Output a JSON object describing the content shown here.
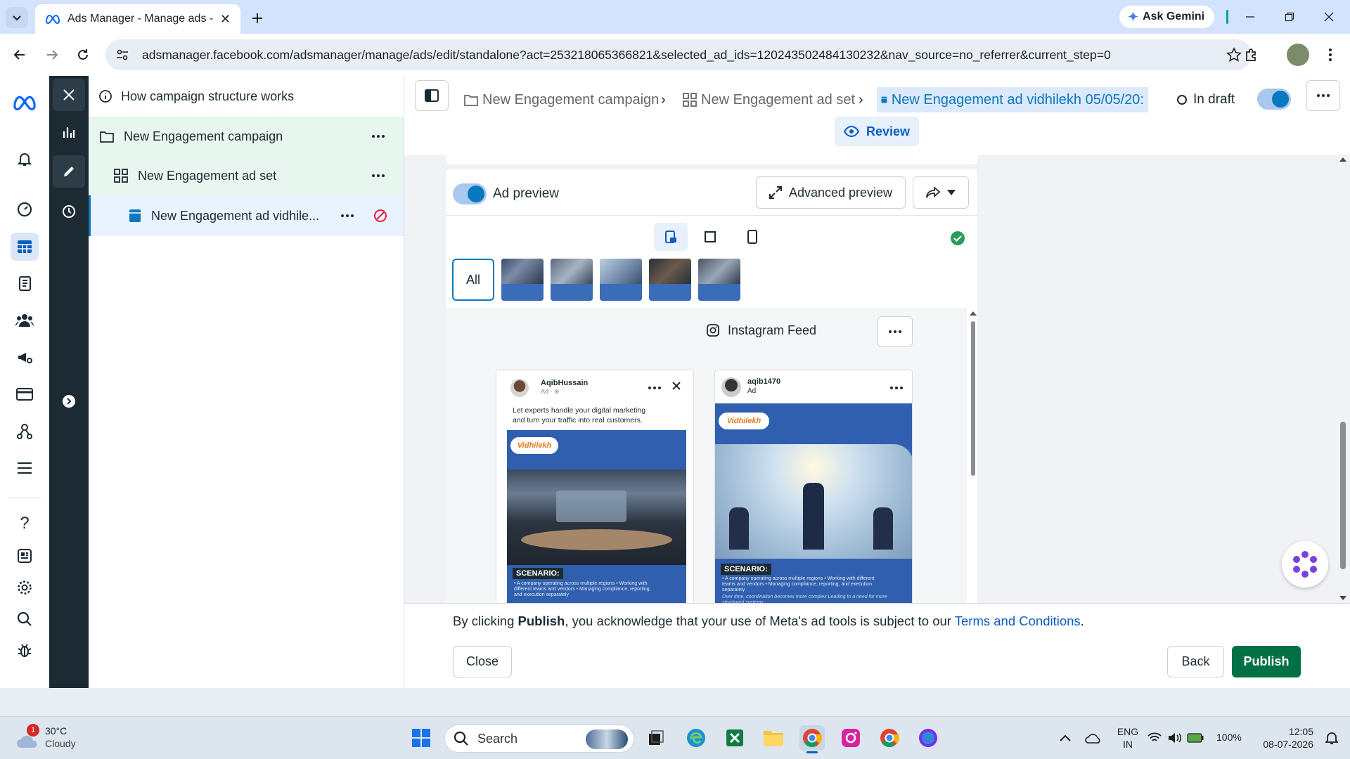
{
  "browser": {
    "tab_title": "Ads Manager - Manage ads - Ad",
    "ask_gemini": "Ask Gemini",
    "url": "adsmanager.facebook.com/adsmanager/manage/ads/edit/standalone?act=253218065366821&selected_ad_ids=120243502484130232&nav_source=no_referrer&current_step=0"
  },
  "tree": {
    "info_label": "How campaign structure works",
    "campaign": "New Engagement campaign",
    "adset": "New Engagement ad set",
    "ad": "New Engagement ad vidhile..."
  },
  "header": {
    "crumb_campaign": "New Engagement campaign",
    "crumb_adset": "New Engagement ad set",
    "crumb_ad": "New Engagement ad vidhilekh 05/05/20:",
    "status": "In draft",
    "review": "Review"
  },
  "preview": {
    "toggle_label": "Ad preview",
    "advanced": "Advanced preview",
    "all": "All",
    "placement": "Instagram Feed",
    "post1": {
      "user": "AqibHussain",
      "sub": "Ad · ⊕",
      "caption": "Let experts handle your digital marketing and turn your traffic into real customers.",
      "brand": "Vidhilekh",
      "scenario": "SCENARIO:",
      "bullets": "• A company operating across multiple regions • Working with different teams and vendors • Managing compliance, reporting, and execution separately"
    },
    "post2": {
      "user": "aqib1470",
      "sub": "Ad",
      "brand": "Vidhilekh",
      "scenario": "SCENARIO:",
      "bullets": "• A company operating across multiple regions • Working with different teams and vendors • Managing compliance, reporting, and execution separately",
      "footer": "Over time, coordination becomes more complex Leading to a need for more structured systems"
    }
  },
  "footer": {
    "terms_prefix": "By clicking ",
    "terms_bold": "Publish",
    "terms_mid": ", you acknowledge that your use of Meta's ad tools is subject to our ",
    "terms_link": "Terms and Conditions",
    "terms_end": ".",
    "close": "Close",
    "back": "Back",
    "publish": "Publish"
  },
  "taskbar": {
    "weather_temp": "30°C",
    "weather_desc": "Cloudy",
    "weather_badge": "1",
    "search": "Search",
    "lang1": "ENG",
    "lang2": "IN",
    "battery": "100%",
    "time": "12:05",
    "date": "08-07-2026"
  },
  "colors": {
    "accent": "#0a78be",
    "publish": "#007045",
    "tree_selected": "#e8f3ff",
    "tree_campaign": "#e7f6ee",
    "dark_rail": "#1c2b33"
  }
}
